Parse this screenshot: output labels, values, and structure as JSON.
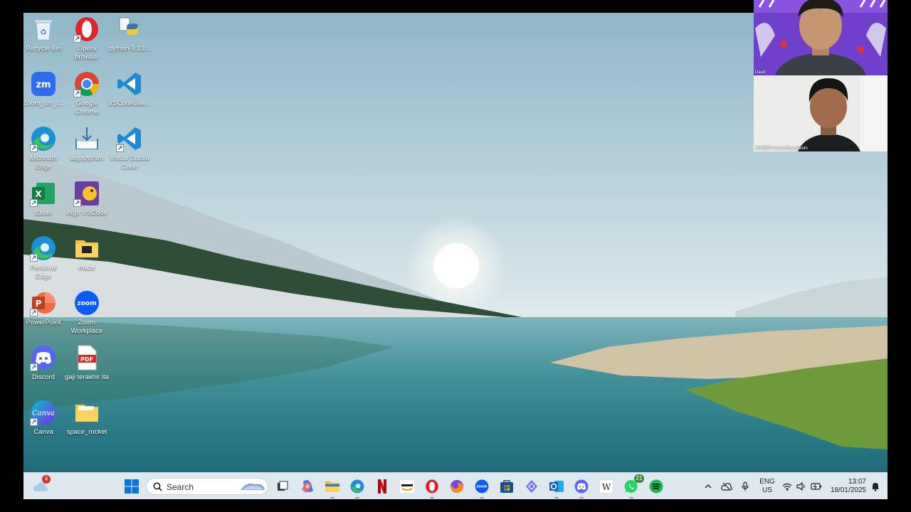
{
  "desktop_icons": [
    {
      "label": "Recycle Bin",
      "icon": "recycle-bin-icon"
    },
    {
      "label": "Opera browser",
      "icon": "opera-icon"
    },
    {
      "label": "python-3.13...",
      "icon": "python-installer-icon"
    },
    {
      "label": "Zoom_cm_f...",
      "icon": "zoom-installer-icon"
    },
    {
      "label": "Google Chrome",
      "icon": "chrome-icon"
    },
    {
      "label": "VSCodeUse...",
      "icon": "vscode-installer-icon"
    },
    {
      "label": "Microsoft Edge",
      "icon": "edge-icon"
    },
    {
      "label": "algopython",
      "icon": "folder-download-icon"
    },
    {
      "label": "Visual Studio Code",
      "icon": "vscode-icon"
    },
    {
      "label": "Excel",
      "icon": "excel-icon"
    },
    {
      "label": "Algo VSCode",
      "icon": "algo-vscode-icon"
    },
    {
      "label": "Personal Edge",
      "icon": "edge-personal-icon"
    },
    {
      "label": "maze",
      "icon": "folder-icon"
    },
    {
      "label": "PowerPoint",
      "icon": "powerpoint-icon"
    },
    {
      "label": "Zoom Workplace",
      "icon": "zoom-icon"
    },
    {
      "label": "Discord",
      "icon": "discord-icon"
    },
    {
      "label": "gaji terakhir ita",
      "icon": "pdf-icon"
    },
    {
      "label": "Canva",
      "icon": "canva-icon"
    },
    {
      "label": "space_rocket",
      "icon": "folder-icon"
    }
  ],
  "taskbar": {
    "weather_badge": "4",
    "search_placeholder": "Search",
    "whatsapp_badge": "21",
    "language": "ENG",
    "region": "US",
    "time": "13:07",
    "date": "18/01/2025",
    "apps": [
      "start-icon",
      "task-view-icon",
      "copilot-icon",
      "file-explorer-icon",
      "edge-icon",
      "netflix-icon",
      "amazon-icon",
      "opera-icon",
      "firefox-icon",
      "zoom-icon",
      "store-icon",
      "copilot-app-icon",
      "outlook-icon",
      "discord-icon",
      "wikipedia-icon",
      "whatsapp-icon",
      "spotify-icon"
    ]
  },
  "video_tiles": [
    {
      "name": "Daud"
    },
    {
      "name": "2526592-fernandhp yoandri"
    }
  ]
}
